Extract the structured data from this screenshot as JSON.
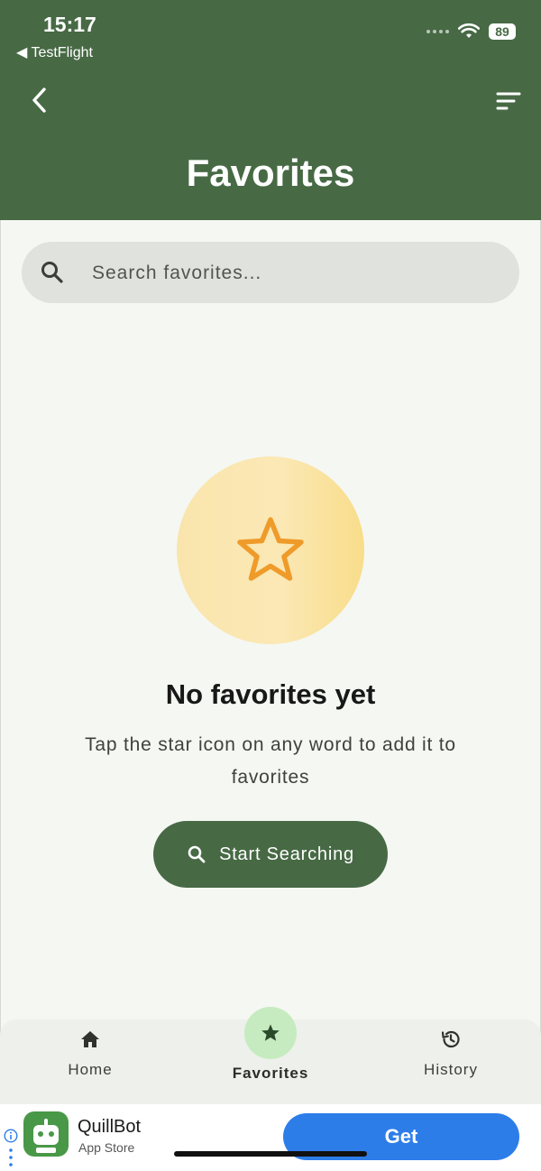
{
  "status_bar": {
    "time": "15:17",
    "back_app": "◀ TestFlight",
    "battery": "89"
  },
  "header": {
    "title": "Favorites",
    "back_icon": "chevron-left-icon",
    "sort_icon": "sort-lines-icon",
    "bg_color": "#476a45"
  },
  "search": {
    "placeholder": "Search favorites...",
    "value": ""
  },
  "empty_state": {
    "title": "No favorites yet",
    "description": "Tap the star icon on any word to add it to favorites",
    "button_label": "Start Searching",
    "icon": "star-outline-icon",
    "accent": "#ef9b2a"
  },
  "bottom_nav": {
    "items": [
      {
        "label": "Home",
        "icon": "home-icon",
        "active": false
      },
      {
        "label": "Favorites",
        "icon": "star-icon",
        "active": true
      },
      {
        "label": "History",
        "icon": "history-icon",
        "active": false
      }
    ]
  },
  "ad": {
    "app_name": "QuillBot",
    "store": "App Store",
    "cta": "Get",
    "cta_color": "#2d7de9"
  }
}
